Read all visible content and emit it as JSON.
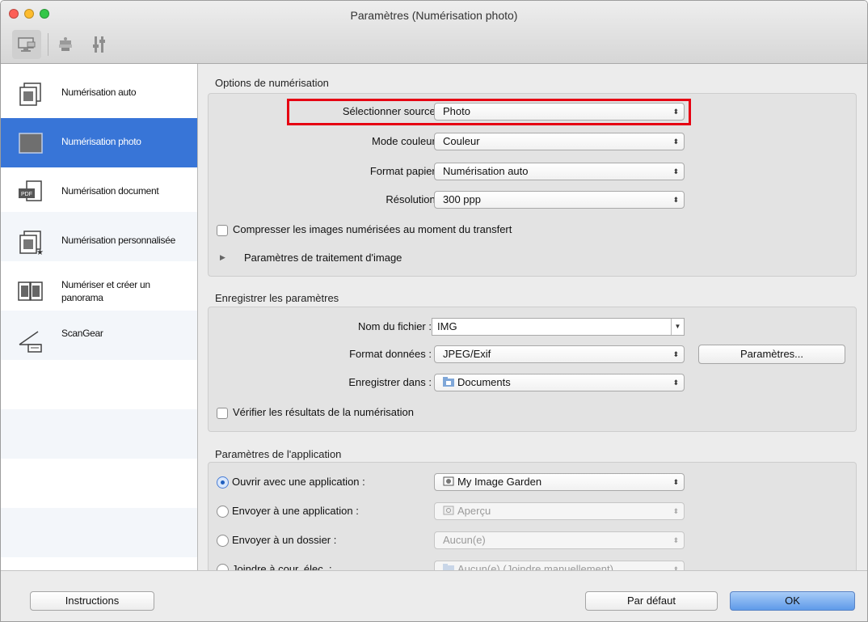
{
  "window": {
    "title": "Paramètres (Numérisation photo)"
  },
  "toolbar": {
    "items": [
      {
        "icon": "scan-from-computer-icon",
        "selected": true
      },
      {
        "icon": "scan-from-panel-icon",
        "selected": false
      },
      {
        "icon": "general-settings-icon",
        "selected": false
      }
    ]
  },
  "sidebar": {
    "items": [
      {
        "label": "Numérisation auto",
        "icon": "auto-scan-icon",
        "selected": false
      },
      {
        "label": "Numérisation photo",
        "icon": "photo-scan-icon",
        "selected": true
      },
      {
        "label": "Numérisation document",
        "icon": "document-scan-icon",
        "selected": false
      },
      {
        "label": "Numérisation personnalisée",
        "icon": "custom-scan-icon",
        "selected": false
      },
      {
        "label": "Numériser et créer un panorama",
        "icon": "panorama-scan-icon",
        "selected": false
      },
      {
        "label": "ScanGear",
        "icon": "scangear-icon",
        "selected": false
      }
    ]
  },
  "scan_options": {
    "title": "Options de numérisation",
    "source_label": "Sélectionner source :",
    "source_value": "Photo",
    "color_mode_label": "Mode couleur :",
    "color_mode_value": "Couleur",
    "paper_size_label": "Format papier :",
    "paper_size_value": "Numérisation auto",
    "resolution_label": "Résolution :",
    "resolution_value": "300 ppp",
    "compress_label": "Compresser les images numérisées au moment du transfert",
    "compress_checked": false,
    "image_processing_label": "Paramètres de traitement d'image"
  },
  "save_settings": {
    "title": "Enregistrer les paramètres",
    "file_name_label": "Nom du fichier :",
    "file_name_value": "IMG",
    "data_format_label": "Format données :",
    "data_format_value": "JPEG/Exif",
    "settings_button": "Paramètres...",
    "save_in_label": "Enregistrer dans :",
    "save_in_value": "Documents",
    "verify_label": "Vérifier les résultats de la numérisation",
    "verify_checked": false
  },
  "app_settings": {
    "title": "Paramètres de l'application",
    "options": [
      {
        "label": "Ouvrir avec une application :",
        "value": "My Image Garden",
        "selected": true,
        "enabled": true,
        "icon": "my-image-garden-icon"
      },
      {
        "label": "Envoyer à une application :",
        "value": "Aperçu",
        "selected": false,
        "enabled": false,
        "icon": "preview-app-icon"
      },
      {
        "label": "Envoyer à un dossier :",
        "value": "Aucun(e)",
        "selected": false,
        "enabled": false,
        "icon": ""
      },
      {
        "label": "Joindre à cour. élec. :",
        "value": "Aucun(e) (Joindre manuellement)",
        "selected": false,
        "enabled": false,
        "icon": "folder-icon"
      }
    ]
  },
  "footer": {
    "instructions_button": "Instructions",
    "defaults_button": "Par défaut",
    "ok_button": "OK"
  },
  "colors": {
    "selection_blue": "#3875d7",
    "highlight_red": "#e60012",
    "default_button": "#5e9ae9"
  }
}
